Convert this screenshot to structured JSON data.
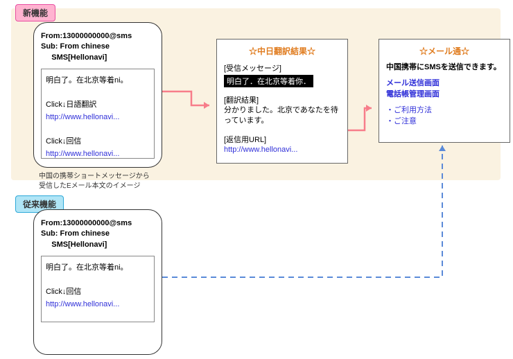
{
  "tags": {
    "new": "新機能",
    "old": "従来機能"
  },
  "phone": {
    "from": "From:13000000000@sms",
    "sub": "Sub: From chinese\n     SMS[Hellonavi]",
    "body_new": {
      "msg": "明白了。在北京等着ni。",
      "act1": "Click↓日語翻訳",
      "url1": "http://www.hellonavi...",
      "act2": "Click↓回信",
      "url2": "http://www.hellonavi..."
    },
    "body_old": {
      "msg": "明白了。在北京等着ni。",
      "act1": "Click↓回信",
      "url1": "http://www.hellonavi..."
    }
  },
  "note": "中国の携帯ショートメッセージから\n受信したEメール本文のイメージ",
  "trans": {
    "title": "☆中日翻訳結果☆",
    "recv_lbl": "[受信メッセージ]",
    "recv_txt": "明白了．在北京等着你．",
    "res_lbl": "[翻訳結果]",
    "res_txt": "分かりました。北京であなたを待っています。",
    "url_lbl": "[返信用URL]",
    "url": "http://www.hellonavi..."
  },
  "mail": {
    "title": "☆メール通☆",
    "desc": "中国携帯にSMSを送信できます。",
    "link1": "メール送信画面",
    "link2": "電話帳管理画面",
    "link3": "・ご利用方法",
    "link4": "・ご注意"
  }
}
